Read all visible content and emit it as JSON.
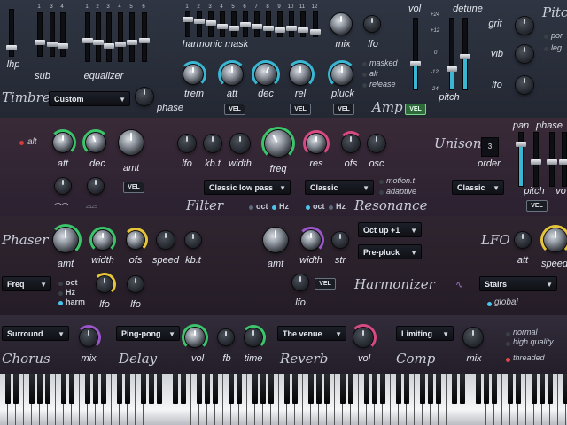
{
  "timbre": {
    "title": "Timbre",
    "fader_labels": {
      "lhp": "lhp",
      "sub": "sub",
      "equalizer": "equalizer",
      "harmonic_mask": "harmonic mask",
      "vol": "vol",
      "detune": "detune",
      "pitch": "pitch"
    },
    "fader_nums": [
      "1",
      "3",
      "4",
      "1",
      "2",
      "3",
      "4",
      "5",
      "6",
      "1",
      "2",
      "3",
      "4",
      "5",
      "6",
      "7",
      "8",
      "9",
      "10",
      "11",
      "12"
    ],
    "preset": "Custom",
    "knob_labels": {
      "phase": "phase",
      "mix": "mix",
      "lfo": "lfo",
      "trem": "trem",
      "att": "att",
      "dec": "dec",
      "rel": "rel",
      "pluck": "pluck"
    },
    "options": [
      "masked",
      "alt",
      "release"
    ],
    "amp_title": "Amp",
    "vel": "VEL",
    "scale": [
      "+24",
      "+12",
      "0",
      "-12",
      "-24"
    ],
    "pitch_title": "Pitch",
    "pitch_opts": [
      "por",
      "leg"
    ],
    "pitch_knobs": {
      "grit": "grit",
      "vib": "vib",
      "lfo": "lfo"
    }
  },
  "filter": {
    "alt_label": "alt",
    "knob_labels": {
      "att": "att",
      "dec": "dec",
      "amt": "amt",
      "lfo": "lfo",
      "kbt": "kb.t",
      "width": "width",
      "freq": "freq",
      "res": "res",
      "ofs": "ofs",
      "osc": "osc"
    },
    "title": "Filter",
    "type": "Classic low pass",
    "oct": "oct",
    "hz": "Hz",
    "resonance_type": "Classic",
    "resonance_title": "Resonance",
    "resonance_opts": [
      "motion.t",
      "adaptive"
    ],
    "vel": "VEL"
  },
  "unison": {
    "title": "Unison",
    "order_value": "3",
    "order_label": "order",
    "mode": "Classic",
    "pan": "pan",
    "phase": "phase",
    "pitch": "pitch",
    "vol": "vo",
    "vel": "VEL"
  },
  "phaser": {
    "title": "Phaser",
    "knob_labels": {
      "amt": "amt",
      "width": "width",
      "ofs": "ofs",
      "speed": "speed",
      "kbt": "kb.t",
      "lfo1": "lfo",
      "lfo2": "lfo"
    },
    "mode": "Freq",
    "opts": [
      "oct",
      "Hz",
      "harm"
    ]
  },
  "harmonizer": {
    "title": "Harmonizer",
    "knob_labels": {
      "amt": "amt",
      "width": "width",
      "str": "str",
      "lfo": "lfo"
    },
    "mode1": "Oct up +1",
    "mode2": "Pre-pluck",
    "vel": "VEL"
  },
  "lfo": {
    "title": "LFO",
    "att": "att",
    "speed": "speed",
    "shape": "Stairs",
    "global": "global"
  },
  "fx": {
    "chorus": {
      "title": "Chorus",
      "mode": "Surround",
      "mix": "mix"
    },
    "delay": {
      "title": "Delay",
      "mode": "Ping-pong",
      "vol": "vol",
      "fb": "fb",
      "time": "time"
    },
    "reverb": {
      "title": "Reverb",
      "mode": "The venue",
      "vol": "vol"
    },
    "comp": {
      "title": "Comp",
      "mode": "Limiting",
      "mix": "mix"
    },
    "quality": [
      "normal",
      "high quality"
    ],
    "threaded": "threaded"
  },
  "colors": {
    "accent_cyan": "#39b7d2",
    "accent_green": "#3bc46a",
    "accent_pink": "#d64a83",
    "accent_yellow": "#e5c43a",
    "accent_purple": "#9a56c9"
  },
  "icons": [
    "up-arrow-icon",
    "down-arrow-icon",
    "knob-icon",
    "wave-icon",
    "stairs-icon"
  ]
}
